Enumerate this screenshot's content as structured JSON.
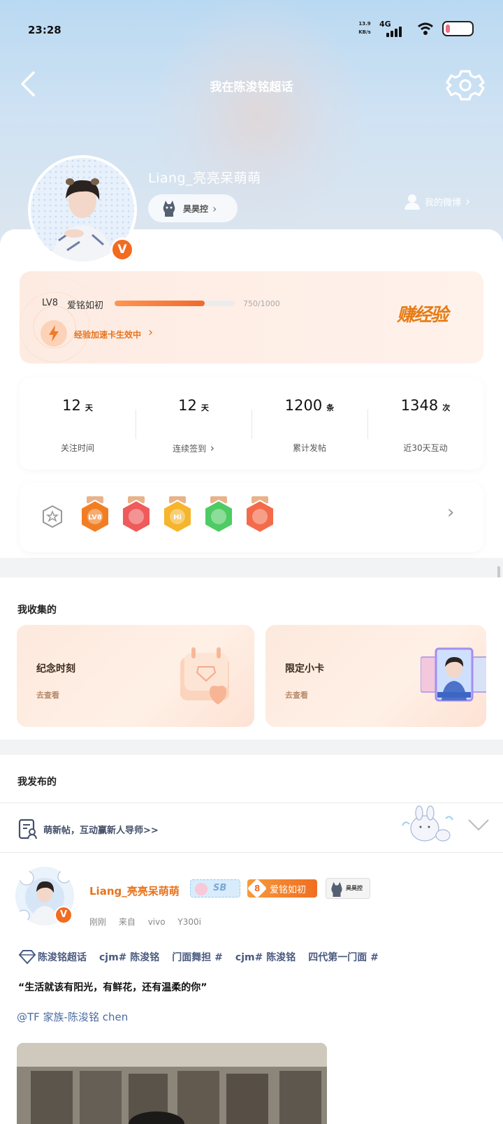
{
  "status_bar": {
    "time": "23:28",
    "net_speed_value": "13.9",
    "net_speed_unit": "KB/s",
    "network": "4G",
    "battery_level_fraction": 0.1
  },
  "header": {
    "title": "我在陈浚铭超话"
  },
  "profile": {
    "username": "Liang_亮亮呆萌萌",
    "fan_tag": "昊昊控",
    "my_weibo": "我的微博"
  },
  "level": {
    "lv": "LV8",
    "title": "爱铭如初",
    "progress_text": "750/1000",
    "progress_fraction": 0.75,
    "speed_text": "经验加速卡生效中",
    "earn_label": "赚经验"
  },
  "stats": [
    {
      "value": "12",
      "unit": "天",
      "label": "关注时间"
    },
    {
      "value": "12",
      "unit": "天",
      "label": "连续签到"
    },
    {
      "value": "1200",
      "unit": "条",
      "label": "累计发帖"
    },
    {
      "value": "1348",
      "unit": "次",
      "label": "近30天互动"
    }
  ],
  "badges": [
    {
      "color": "#f27e24",
      "inner": "LV8"
    },
    {
      "color": "#ef5a5a",
      "inner": ""
    },
    {
      "color": "#f5b52c",
      "inner": "Hi"
    },
    {
      "color": "#4ecb63",
      "inner": ""
    },
    {
      "color": "#f36b4a",
      "inner": ""
    }
  ],
  "collections": {
    "title": "我收集的",
    "items": [
      {
        "title": "纪念时刻",
        "sub": "去查看"
      },
      {
        "title": "限定小卡",
        "sub": "去查看"
      }
    ]
  },
  "posted": {
    "title": "我发布的",
    "newbie_text": "萌新帖，互动赢新人导师>>"
  },
  "post": {
    "author": "Liang_亮亮呆萌萌",
    "tag_sb": "SB",
    "tag_level_num": "8",
    "tag_level_text": "爱铭如初",
    "tag_fan": "昊昊控",
    "time": "刚刚",
    "source_prefix": "来自",
    "source_brand": "vivo",
    "source_model": "Y300i",
    "topics": [
      "陈浚铭超话",
      "cjm# 陈浚铭",
      "门面舞担 #",
      "cjm# 陈浚铭",
      "四代第一门面 #"
    ],
    "content": "“生活就该有阳光，有鲜花，还有温柔的你”",
    "mention": "@TF 家族-陈浚铭 chen"
  },
  "colors": {
    "accent_orange": "#e8731c",
    "link_blue": "#4a6aa0",
    "hero_blue": "#b9d9f2"
  }
}
